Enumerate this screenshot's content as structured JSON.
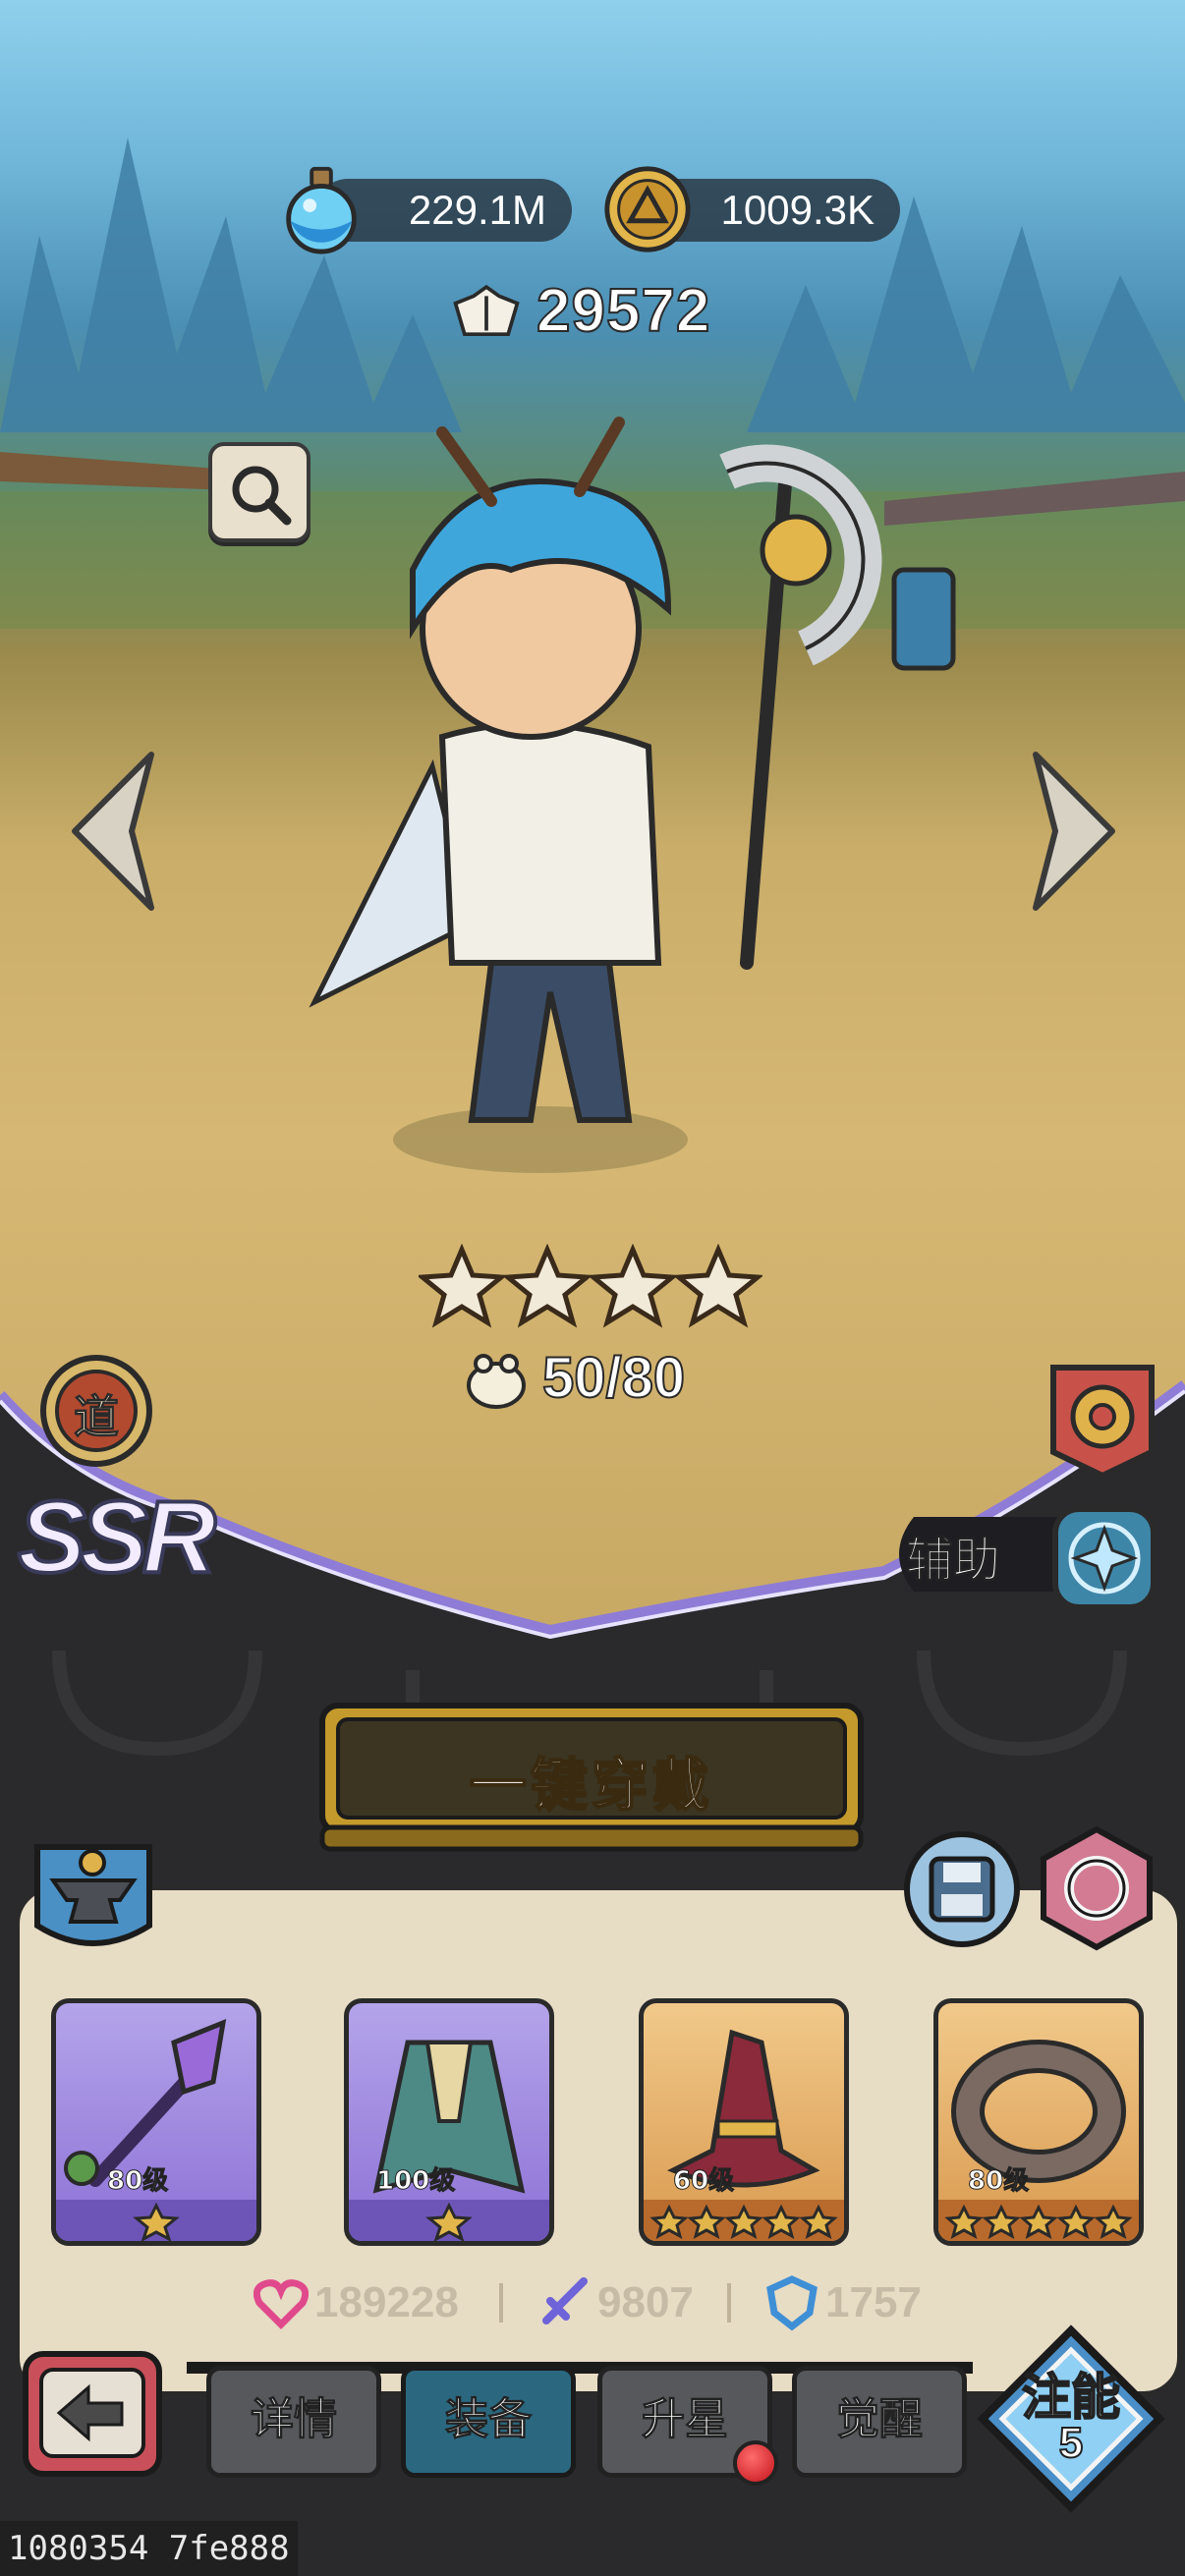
{
  "resources": {
    "potion": {
      "value": "229.1M",
      "icon": "blue-potion-icon"
    },
    "coin": {
      "value": "1009.3K",
      "icon": "gold-coin-icon"
    }
  },
  "power": {
    "value": "29572",
    "icon": "combat-power-icon"
  },
  "hero": {
    "rarity": "SSR",
    "faction_badge": "道",
    "stars": 4,
    "exp": "50/80",
    "role": "辅助"
  },
  "actions": {
    "equip_all": "一键穿戴"
  },
  "equipment": [
    {
      "name": "staff",
      "level": "80级",
      "stars": 1,
      "quality": "purple"
    },
    {
      "name": "cloak",
      "level": "100级",
      "stars": 1,
      "quality": "purple"
    },
    {
      "name": "hat",
      "level": "60级",
      "stars": 5,
      "quality": "orange"
    },
    {
      "name": "ring",
      "level": "80级",
      "stars": 5,
      "quality": "orange"
    }
  ],
  "stats": {
    "hp": {
      "value": "189228",
      "color": "#e04a8c"
    },
    "attack": {
      "value": "9807",
      "color": "#6e63d8"
    },
    "defense": {
      "value": "1757",
      "color": "#3e8fd6"
    }
  },
  "tabs": [
    {
      "label": "详情",
      "active": false
    },
    {
      "label": "装备",
      "active": true
    },
    {
      "label": "升星",
      "active": false,
      "badge": true
    },
    {
      "label": "觉醒",
      "active": false
    }
  ],
  "zhuneng": {
    "label": "注能",
    "count": "5"
  },
  "footer_id": "1080354 7fe888",
  "colors": {
    "accent_gold": "#c9a227",
    "tab_active": "#2b6880",
    "panel_bg": "#e7dcc4",
    "dark_bg": "#2a2a2c"
  }
}
